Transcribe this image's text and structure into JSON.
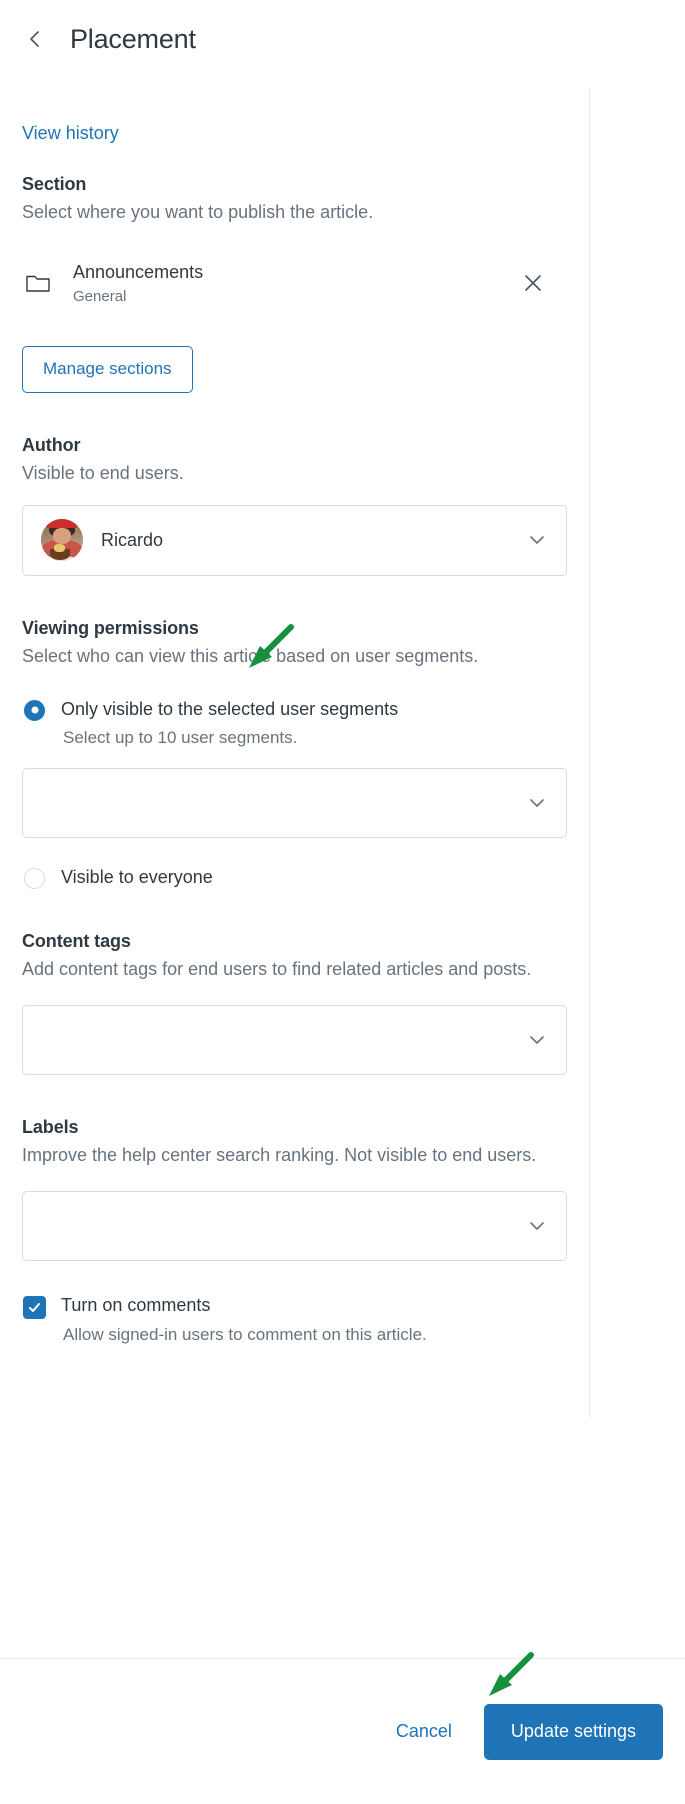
{
  "header": {
    "back_icon": "chevron-left-icon",
    "title": "Placement"
  },
  "view_history": {
    "label": "View history"
  },
  "section": {
    "title": "Section",
    "description": "Select where you want to publish the article.",
    "folder_icon": "folder-icon",
    "name": "Announcements",
    "parent": "General",
    "remove_icon": "close-icon",
    "manage_button": "Manage sections"
  },
  "author": {
    "title": "Author",
    "description": "Visible to end users.",
    "selected": "Ricardo",
    "avatar": "user-avatar-photo",
    "chevron_icon": "chevron-down-icon"
  },
  "viewing_permissions": {
    "title": "Viewing permissions",
    "description": "Select who can view this article based on user segments.",
    "options": [
      {
        "label": "Only visible to the selected user segments",
        "sublabel": "Select up to 10 user segments.",
        "selected": true
      },
      {
        "label": "Visible to everyone",
        "selected": false
      }
    ],
    "segments_value": "",
    "segments_chevron_icon": "chevron-down-icon"
  },
  "content_tags": {
    "title": "Content tags",
    "description": "Add content tags for end users to find related articles and posts.",
    "value": "",
    "chevron_icon": "chevron-down-icon"
  },
  "labels": {
    "title": "Labels",
    "description": "Improve the help center search ranking. Not visible to end users.",
    "value": "",
    "chevron_icon": "chevron-down-icon"
  },
  "comments": {
    "label": "Turn on comments",
    "sublabel": "Allow signed-in users to comment on this article.",
    "checked": true,
    "check_icon": "check-icon"
  },
  "footer": {
    "cancel_label": "Cancel",
    "submit_label": "Update settings"
  },
  "annotations": [
    {
      "name": "arrow-to-viewing-permissions",
      "color": "#108043"
    },
    {
      "name": "arrow-to-update-settings",
      "color": "#108043"
    }
  ],
  "colors": {
    "accent": "#1f73b7",
    "text": "#2f3941",
    "muted": "#68737d",
    "border": "#d8dcde",
    "annotation_green": "#168f3f"
  }
}
